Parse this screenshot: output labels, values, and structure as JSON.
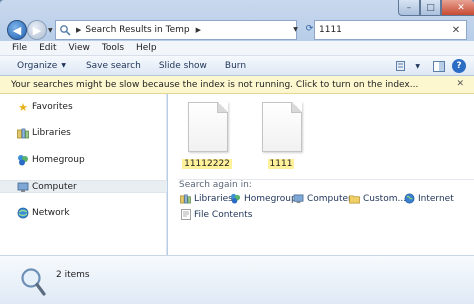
{
  "window": {
    "minimize_icon": "minimize-icon",
    "maximize_icon": "maximize-icon",
    "close_icon": "close-icon"
  },
  "address": {
    "path": "Search Results in Temp",
    "back_icon": "back-arrow-icon",
    "forward_icon": "forward-arrow-icon"
  },
  "search": {
    "value": "1111"
  },
  "menu": [
    "File",
    "Edit",
    "View",
    "Tools",
    "Help"
  ],
  "toolbar": {
    "organize": "Organize",
    "save_search": "Save search",
    "slide_show": "Slide show",
    "burn": "Burn"
  },
  "infobar": {
    "message": "Your searches might be slow because the index is not running.  Click to turn on the index..."
  },
  "navpane": {
    "items": [
      "Favorites",
      "Libraries",
      "Homegroup",
      "Computer",
      "Network"
    ]
  },
  "files": [
    {
      "name": "11112222",
      "type": "file"
    },
    {
      "name": "1111",
      "type": "file"
    }
  ],
  "search_again": {
    "heading": "Search again in:",
    "locations": [
      "Libraries",
      "Homegroup",
      "Computer",
      "Custom...",
      "Internet",
      "File Contents"
    ]
  },
  "details": {
    "count": "2 items"
  },
  "colors": {
    "highlight": "#fff09a",
    "infobar": "#fdf7cf",
    "accent": "#2b5ea5"
  }
}
